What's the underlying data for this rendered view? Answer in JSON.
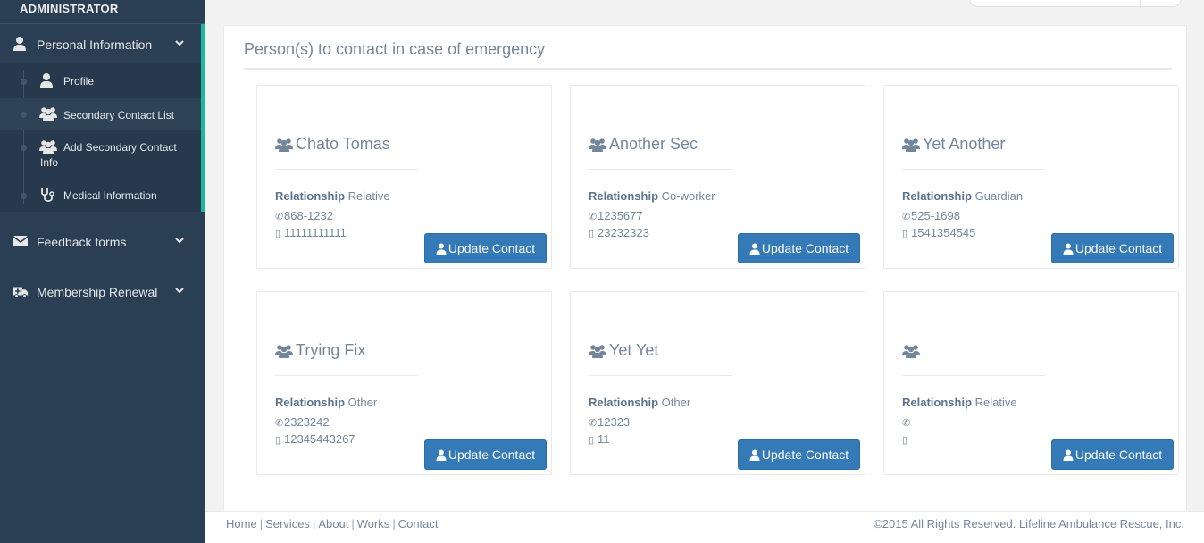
{
  "sidebar": {
    "role": "ADMINISTRATOR",
    "menu": [
      {
        "label": "Personal Information",
        "icon": "user-icon"
      },
      {
        "label": "Feedback forms",
        "icon": "envelope-icon"
      },
      {
        "label": "Membership Renewal",
        "icon": "ambulance-icon"
      }
    ],
    "submenu": [
      {
        "label": "Profile",
        "icon": "user-icon"
      },
      {
        "label": "Secondary Contact List",
        "icon": "users-icon"
      },
      {
        "label_line1": "Add Secondary Contact",
        "label_line2": "Info",
        "icon": "users-icon"
      },
      {
        "label": "Medical Information",
        "icon": "stethoscope-icon"
      }
    ]
  },
  "panel": {
    "title": "Person(s) to contact in case of emergency"
  },
  "relationship_label": "Relationship",
  "update_button_label": "Update Contact",
  "contacts": [
    {
      "name": "Chato Tomas",
      "relationship": "Relative",
      "phone": "868-1232",
      "mobile": "11111111111"
    },
    {
      "name": "Another Sec",
      "relationship": "Co-worker",
      "phone": "1235677",
      "mobile": "23232323"
    },
    {
      "name": "Yet Another",
      "relationship": "Guardian",
      "phone": "525-1698",
      "mobile": "1541354545"
    },
    {
      "name": "Trying Fix",
      "relationship": "Other",
      "phone": "2323242",
      "mobile": "12345443267"
    },
    {
      "name": "Yet Yet",
      "relationship": "Other",
      "phone": "12323",
      "mobile": "11"
    },
    {
      "name": "",
      "relationship": "Relative",
      "phone": "",
      "mobile": ""
    }
  ],
  "footer": {
    "links": [
      "Home",
      "Services",
      "About",
      "Works",
      "Contact"
    ],
    "copyright": "©2015 All Rights Reserved. Lifeline Ambulance Rescue, Inc."
  },
  "colors": {
    "sidebar_bg": "#2a3f54",
    "accent": "#1abb9c",
    "button": "#337ab7",
    "text": "#73879c"
  }
}
